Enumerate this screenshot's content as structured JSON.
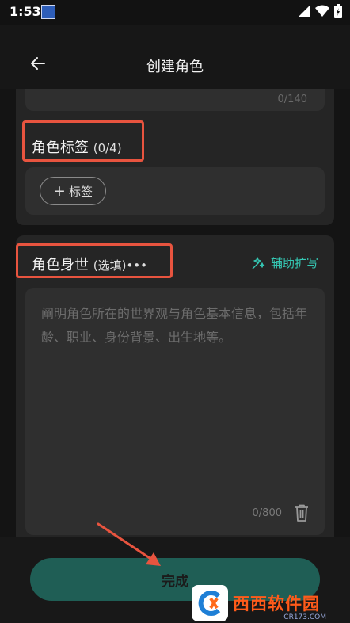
{
  "status_bar": {
    "time": "1:53"
  },
  "app_bar": {
    "title": "创建角色"
  },
  "previous_field": {
    "counter": "0/140"
  },
  "tags_section": {
    "label": "角色标签",
    "count": "(0/4)",
    "add_tag_label": "标签"
  },
  "background_section": {
    "label": "角色身世",
    "optional": "(选填)•••",
    "assist_label": "辅助扩写",
    "placeholder": "阐明角色所在的世界观与角色基本信息，包括年龄、职业、身份背景、出生地等。",
    "counter": "0/800"
  },
  "footer": {
    "done_label": "完成"
  },
  "watermark": {
    "brand": "西西软件园",
    "site": "CR173.COM"
  },
  "colors": {
    "accent": "#35c9b5",
    "done_button": "#1f5e55",
    "annotation": "#e8543f"
  }
}
